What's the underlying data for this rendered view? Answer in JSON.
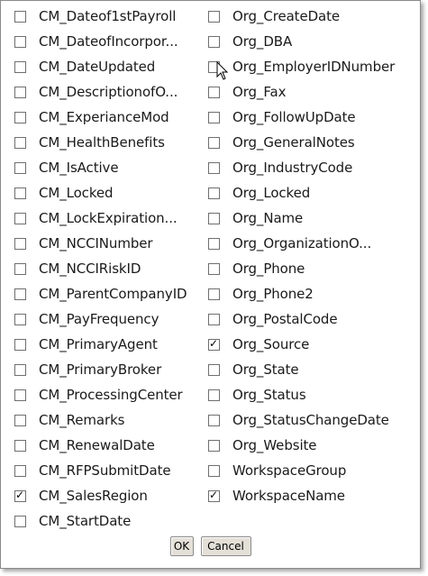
{
  "left_column": [
    {
      "label": "CM_Dateof1stPayroll",
      "checked": false
    },
    {
      "label": "CM_DateofIncorpor...",
      "checked": false
    },
    {
      "label": "CM_DateUpdated",
      "checked": false
    },
    {
      "label": "CM_DescriptionofO...",
      "checked": false
    },
    {
      "label": "CM_ExperianceMod",
      "checked": false
    },
    {
      "label": "CM_HealthBenefits",
      "checked": false
    },
    {
      "label": "CM_IsActive",
      "checked": false
    },
    {
      "label": "CM_Locked",
      "checked": false
    },
    {
      "label": "CM_LockExpiration...",
      "checked": false
    },
    {
      "label": "CM_NCCINumber",
      "checked": false
    },
    {
      "label": "CM_NCCIRiskID",
      "checked": false
    },
    {
      "label": "CM_ParentCompanyID",
      "checked": false
    },
    {
      "label": "CM_PayFrequency",
      "checked": false
    },
    {
      "label": "CM_PrimaryAgent",
      "checked": false
    },
    {
      "label": "CM_PrimaryBroker",
      "checked": false
    },
    {
      "label": "CM_ProcessingCenter",
      "checked": false
    },
    {
      "label": "CM_Remarks",
      "checked": false
    },
    {
      "label": "CM_RenewalDate",
      "checked": false
    },
    {
      "label": "CM_RFPSubmitDate",
      "checked": false
    },
    {
      "label": "CM_SalesRegion",
      "checked": true
    },
    {
      "label": "CM_StartDate",
      "checked": false
    }
  ],
  "right_column": [
    {
      "label": "Org_CreateDate",
      "checked": false
    },
    {
      "label": "Org_DBA",
      "checked": false
    },
    {
      "label": "Org_EmployerIDNumber",
      "checked": false
    },
    {
      "label": "Org_Fax",
      "checked": false
    },
    {
      "label": "Org_FollowUpDate",
      "checked": false
    },
    {
      "label": "Org_GeneralNotes",
      "checked": false
    },
    {
      "label": "Org_IndustryCode",
      "checked": false
    },
    {
      "label": "Org_Locked",
      "checked": false
    },
    {
      "label": "Org_Name",
      "checked": false
    },
    {
      "label": "Org_OrganizationO...",
      "checked": false
    },
    {
      "label": "Org_Phone",
      "checked": false
    },
    {
      "label": "Org_Phone2",
      "checked": false
    },
    {
      "label": "Org_PostalCode",
      "checked": false
    },
    {
      "label": "Org_Source",
      "checked": true
    },
    {
      "label": "Org_State",
      "checked": false
    },
    {
      "label": "Org_Status",
      "checked": false
    },
    {
      "label": "Org_StatusChangeDate",
      "checked": false
    },
    {
      "label": "Org_Website",
      "checked": false
    },
    {
      "label": "WorkspaceGroup",
      "checked": false
    },
    {
      "label": "WorkspaceName",
      "checked": true
    }
  ],
  "buttons": {
    "ok_label": "OK",
    "cancel_label": "Cancel"
  },
  "cursor": {
    "icon": "mouse-pointer-icon"
  }
}
